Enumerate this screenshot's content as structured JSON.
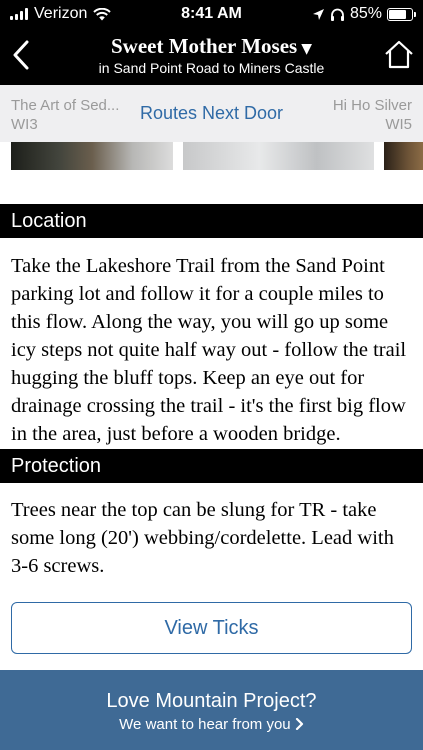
{
  "status_bar": {
    "carrier": "Verizon",
    "time": "8:41 AM",
    "battery_percent_label": "85%",
    "battery_level": 0.85
  },
  "header": {
    "title": "Sweet Mother Moses",
    "subtitle": "in Sand Point Road to Miners Castle",
    "back_icon": "chevron-left-icon",
    "home_icon": "home-icon"
  },
  "route_nav": {
    "prev_name": "The Art of Sed...",
    "prev_grade": "WI3",
    "center_label": "Routes Next Door",
    "next_name": "Hi Ho Silver",
    "next_grade": "WI5"
  },
  "location": {
    "heading": "Location",
    "text": "Take the Lakeshore Trail from the Sand Point parking lot and follow it for a couple miles to this flow. Along the way, you will go up some icy steps not quite half way out - follow the trail hugging the bluff tops. Keep an eye out for drainage crossing the trail - it's the first big flow in the area, just before a wooden bridge."
  },
  "protection": {
    "heading": "Protection",
    "text": "Trees near the top can be slung for TR - take some long (20') webbing/cordelette. Lead with 3-6 screws."
  },
  "actions": {
    "view_ticks_label": "View Ticks"
  },
  "feedback": {
    "title": "Love Mountain Project?",
    "subtitle": "We want to hear from you"
  },
  "colors": {
    "accent": "#2f6aa6",
    "feedback_bg": "#3f6a95",
    "header_bg": "#000000"
  }
}
